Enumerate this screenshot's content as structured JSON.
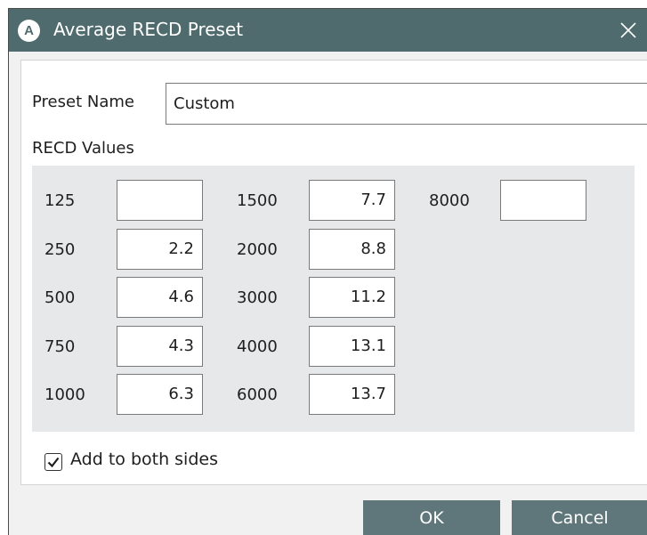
{
  "window": {
    "app_icon_letter": "A",
    "title": "Average RECD Preset",
    "close_glyph": "✕"
  },
  "form": {
    "preset_name_label": "Preset Name",
    "preset_name_value": "Custom",
    "recd_values_label": "RECD Values",
    "recd": {
      "f125": {
        "freq": "125",
        "value": ""
      },
      "f250": {
        "freq": "250",
        "value": "2.2"
      },
      "f500": {
        "freq": "500",
        "value": "4.6"
      },
      "f750": {
        "freq": "750",
        "value": "4.3"
      },
      "f1000": {
        "freq": "1000",
        "value": "6.3"
      },
      "f1500": {
        "freq": "1500",
        "value": "7.7"
      },
      "f2000": {
        "freq": "2000",
        "value": "8.8"
      },
      "f3000": {
        "freq": "3000",
        "value": "11.2"
      },
      "f4000": {
        "freq": "4000",
        "value": "13.1"
      },
      "f6000": {
        "freq": "6000",
        "value": "13.7"
      },
      "f8000": {
        "freq": "8000",
        "value": ""
      }
    },
    "add_both_sides_label": "Add to both sides",
    "add_both_sides_checked": true
  },
  "buttons": {
    "ok": "OK",
    "cancel": "Cancel"
  },
  "colors": {
    "titlebar": "#4f6b6e",
    "button": "#5f777a",
    "grid_background": "#e6e8e9"
  },
  "icons": {
    "app": "circle-a-icon",
    "close": "close-icon",
    "check": "checkmark-icon"
  }
}
